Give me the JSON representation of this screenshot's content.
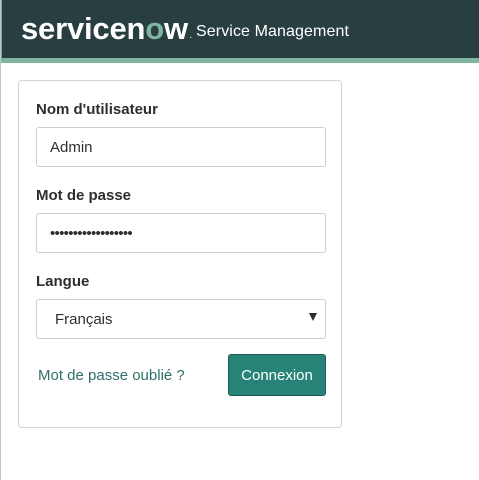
{
  "header": {
    "logo_text": "servicenow",
    "logo_parts": {
      "prefix": "servicen",
      "o": "o",
      "suffix": "w",
      "tm": "."
    },
    "subtitle": "Service Management"
  },
  "form": {
    "username_label": "Nom d'utilisateur",
    "username_value": "Admin",
    "password_label": "Mot de passe",
    "password_value": "••••••••••••••••••",
    "language_label": "Langue",
    "language_value": "Français",
    "forgot_password": "Mot de passe oublié ?",
    "login_button": "Connexion"
  },
  "colors": {
    "header_bg": "#293e40",
    "header_accent": "#81b5a1",
    "button_bg": "#278377",
    "link": "#2f6f68"
  },
  "icons": {
    "dropdown": "chevron-down-icon"
  }
}
